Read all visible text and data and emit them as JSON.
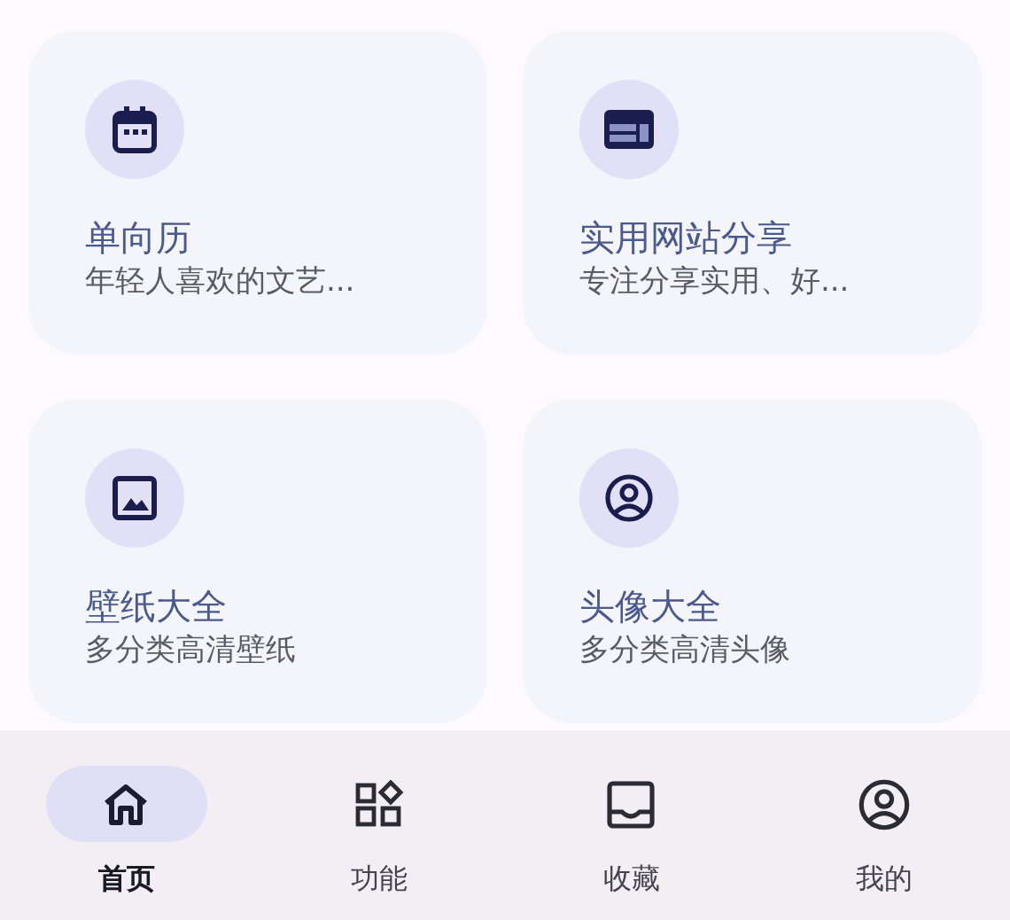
{
  "cards": [
    {
      "kind": "calendar",
      "title": "单向历",
      "subtitle": "年轻人喜欢的文艺..."
    },
    {
      "kind": "website",
      "title": "实用网站分享",
      "subtitle": "专注分享实用、好..."
    },
    {
      "kind": "image",
      "title": "壁纸大全",
      "subtitle": "多分类高清壁纸"
    },
    {
      "kind": "account",
      "title": "头像大全",
      "subtitle": "多分类高清头像"
    }
  ],
  "nav": [
    {
      "kind": "home",
      "label": "首页",
      "selected": true
    },
    {
      "kind": "widgets",
      "label": "功能",
      "selected": false
    },
    {
      "kind": "inbox",
      "label": "收藏",
      "selected": false
    },
    {
      "kind": "account",
      "label": "我的",
      "selected": false
    }
  ]
}
